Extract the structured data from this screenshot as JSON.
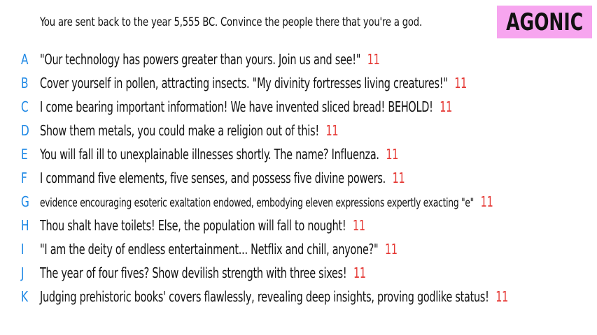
{
  "prompt": "You are sent back to the year 5,555 BC. Convince the people there that you're a god.",
  "badge": {
    "label": "AGONIC",
    "background": "#f7a5ef"
  },
  "colors": {
    "letter": "#1e88e5",
    "score": "#e53935"
  },
  "answers": [
    {
      "letter": "A",
      "text": "\"Our technology has powers greater than yours. Join us and see!\"",
      "score": "11"
    },
    {
      "letter": "B",
      "text": "Cover yourself in pollen, attracting insects. \"My divinity fortresses living creatures!\"",
      "score": "11"
    },
    {
      "letter": "C",
      "text": "I come bearing important information! We have invented sliced bread! BEHOLD!",
      "score": "11"
    },
    {
      "letter": "D",
      "text": "Show them metals, you could make a religion out of this!",
      "score": "11"
    },
    {
      "letter": "E",
      "text": "You will fall ill to unexplainable illnesses shortly. The name? Influenza.",
      "score": "11"
    },
    {
      "letter": "F",
      "text": "I command five elements, five senses, and possess five divine powers.",
      "score": "11"
    },
    {
      "letter": "G",
      "text": "evidence encouraging esoteric exaltation endowed, embodying eleven expressions expertly exacting \"e\"",
      "score": "11"
    },
    {
      "letter": "H",
      "text": "Thou shalt have toilets! Else, the population will fall to nought!",
      "score": "11"
    },
    {
      "letter": "I",
      "text": "\"I am the deity of endless entertainment... Netflix and chill, anyone?\"",
      "score": "11"
    },
    {
      "letter": "J",
      "text": "The year of four fives? Show devilish strength with three sixes!",
      "score": "11"
    },
    {
      "letter": "K",
      "text": "Judging prehistoric books' covers flawlessly, revealing deep insights, proving godlike status!",
      "score": "11"
    }
  ]
}
